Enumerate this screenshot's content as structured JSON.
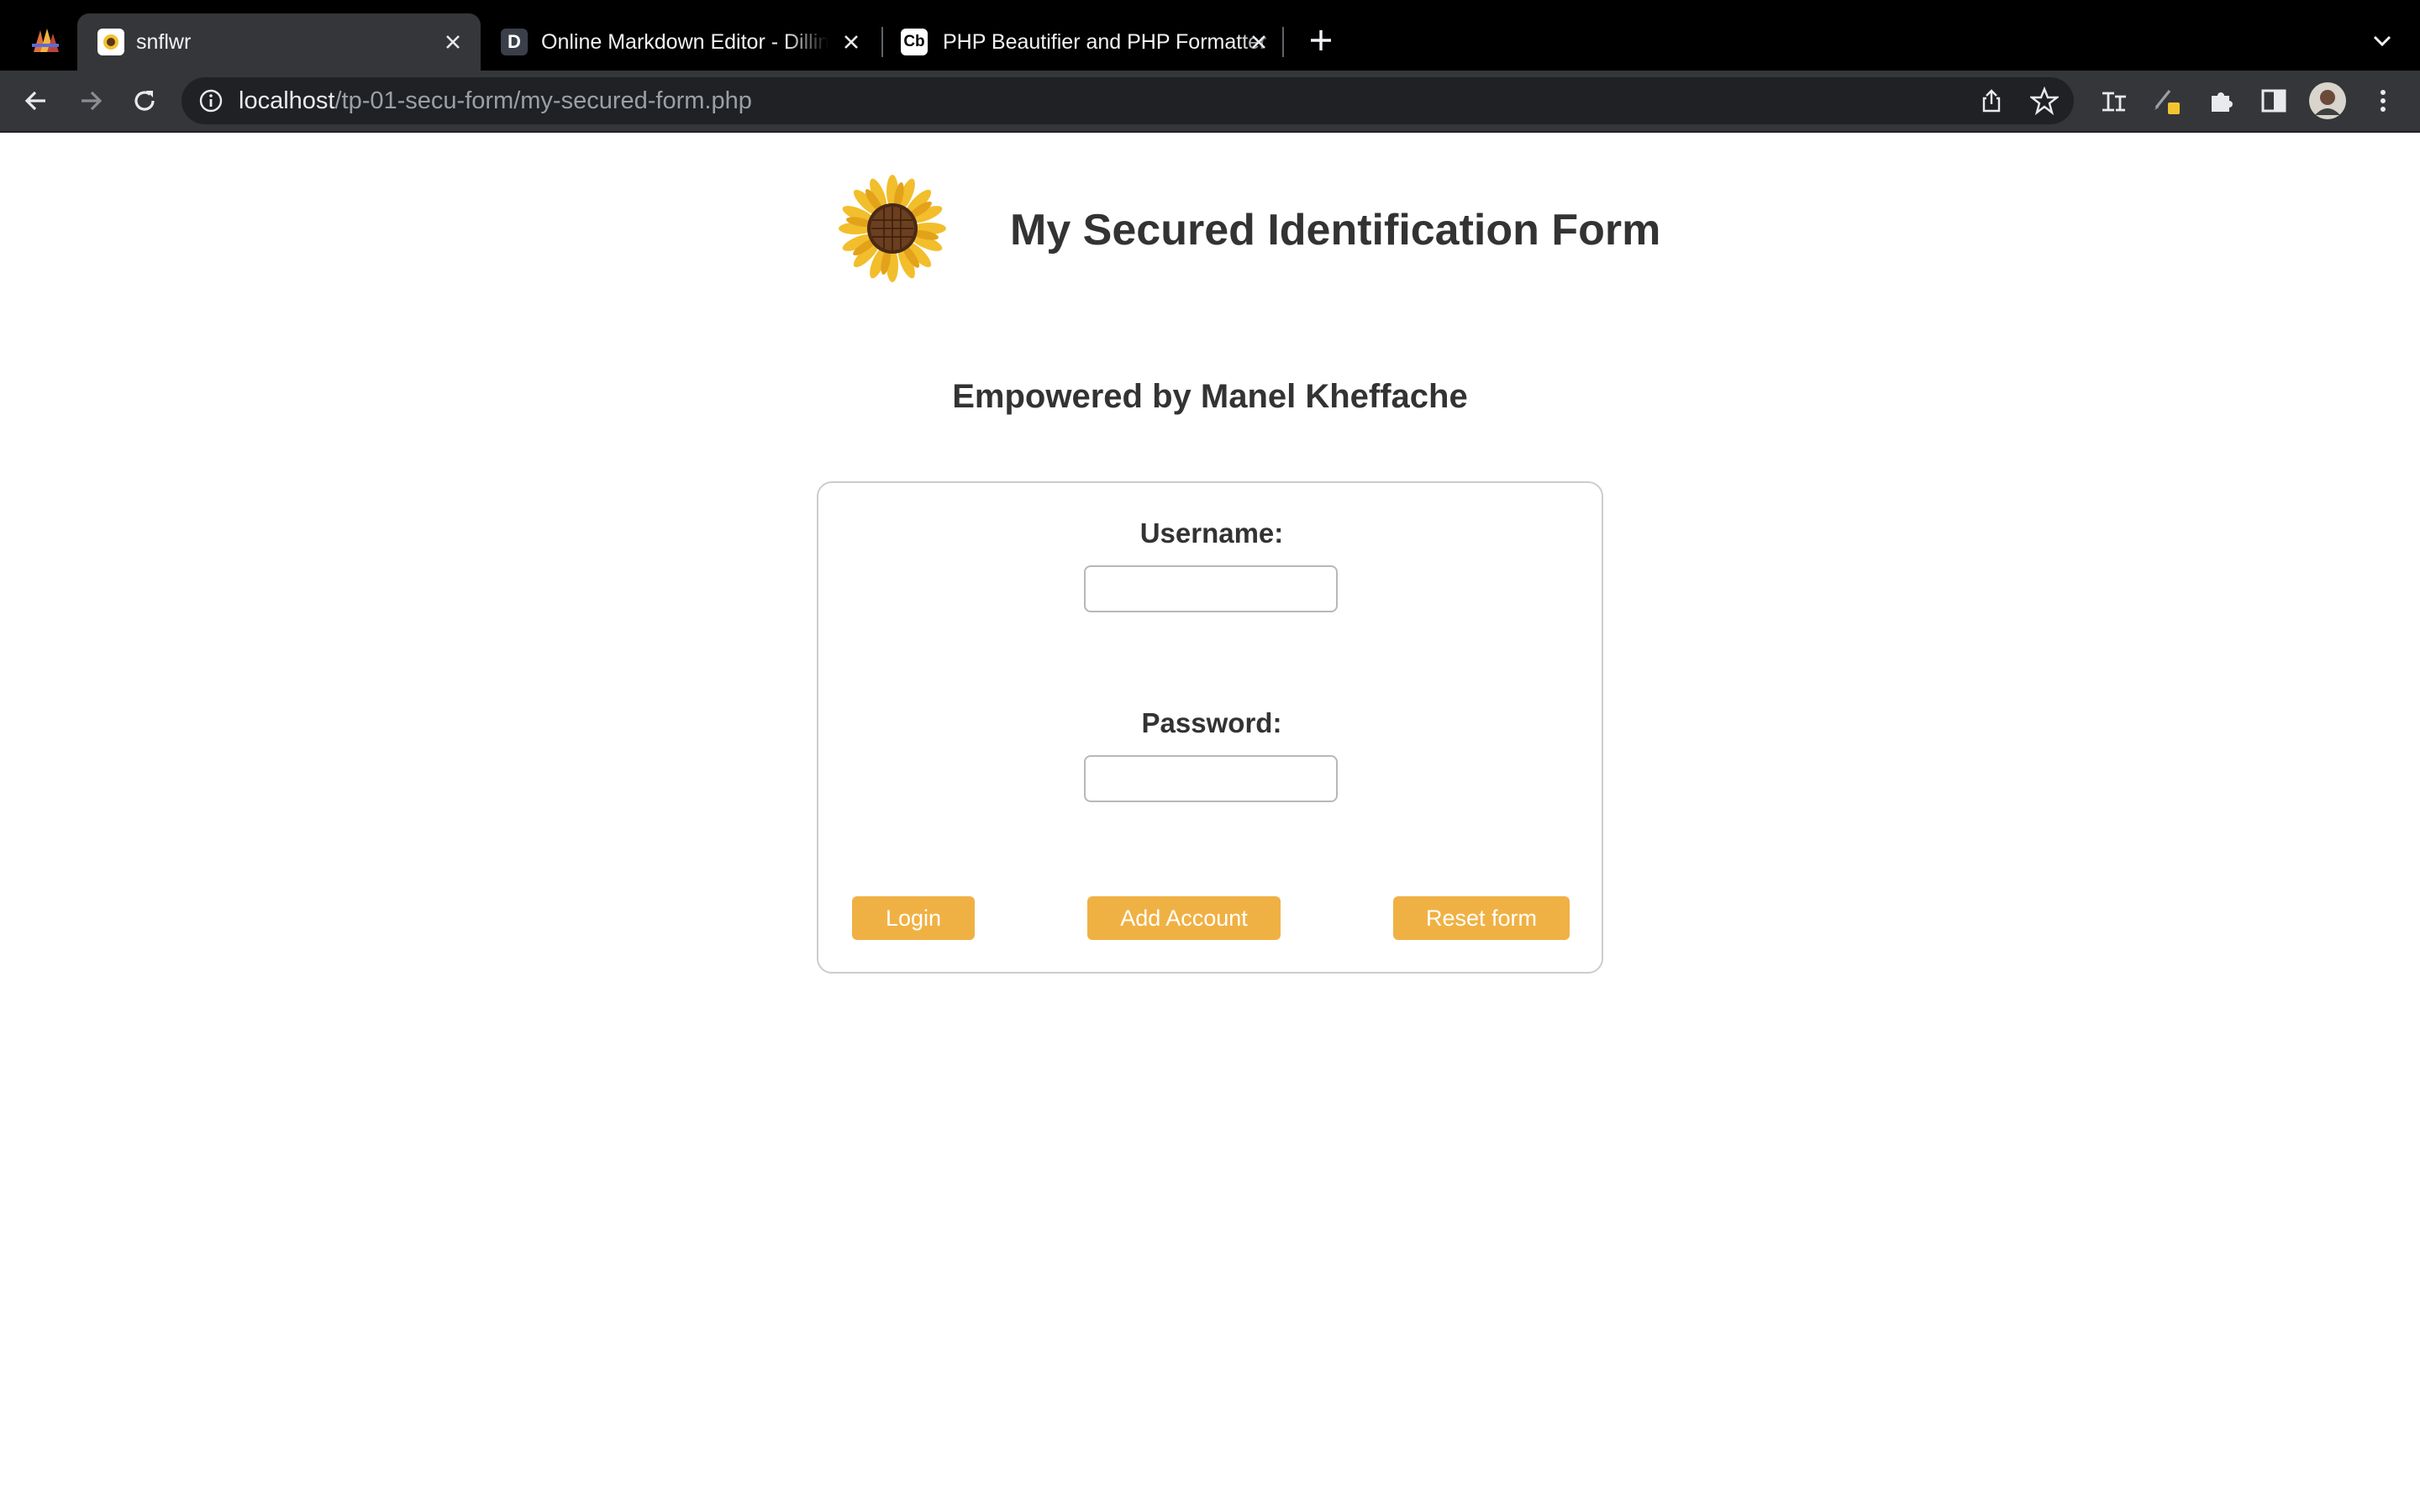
{
  "browser": {
    "tabs": [
      {
        "title": "snflwr",
        "favicon": "sunflower-favicon"
      },
      {
        "title": "Online Markdown Editor - Dillinger",
        "favicon": "dillinger-favicon",
        "favicon_text": "D"
      },
      {
        "title": "PHP Beautifier and PHP Formatter",
        "favicon": "codebeautify-favicon",
        "favicon_text": "Cb"
      }
    ],
    "new_tab_icon": "plus-icon",
    "tab_search_icon": "chevron-down-icon",
    "address_bar": {
      "host": "localhost",
      "path": "/tp-01-secu-form/my-secured-form.php"
    },
    "toolbar_icons": [
      "back-arrow-icon",
      "forward-arrow-icon",
      "reload-icon",
      "site-info-icon",
      "share-icon",
      "bookmark-star-icon",
      "translate-extension-icon",
      "pen-extension-icon",
      "extensions-puzzle-icon",
      "side-panel-icon",
      "profile-avatar-icon",
      "more-menu-icon"
    ]
  },
  "page": {
    "title": "My Secured Identification Form",
    "subtitle": "Empowered by Manel Kheffache",
    "logo": "sunflower-icon",
    "form": {
      "username_label": "Username:",
      "username_value": "",
      "password_label": "Password:",
      "password_value": "",
      "buttons": {
        "login": "Login",
        "add_account": "Add Account",
        "reset": "Reset form"
      }
    }
  },
  "colors": {
    "button": "#f0b144",
    "heading_text": "#333333",
    "form_border": "#cccccc",
    "tabbar_bg": "#000000",
    "toolbar_bg": "#35363a"
  }
}
